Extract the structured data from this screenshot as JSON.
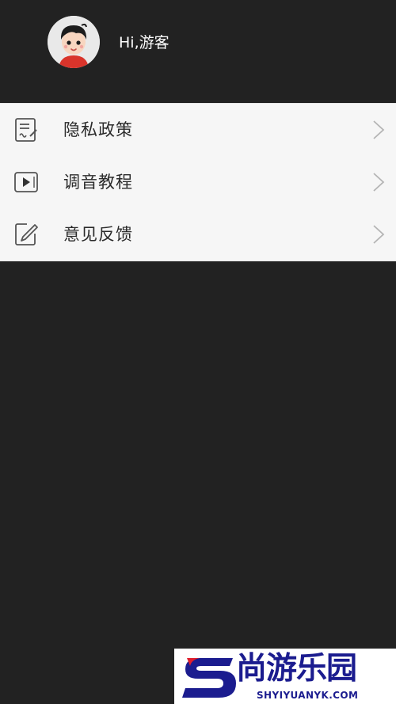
{
  "header": {
    "greeting": "Hi,游客",
    "avatar_icon": "cartoon-avatar"
  },
  "menu": {
    "items": [
      {
        "label": "隐私政策",
        "icon": "document-edit-icon"
      },
      {
        "label": "调音教程",
        "icon": "video-play-icon"
      },
      {
        "label": "意见反馈",
        "icon": "pencil-edit-icon"
      }
    ]
  },
  "watermark": {
    "text": "尚游乐园",
    "subtext": "SHYIYUANYK.COM",
    "logo": "S"
  },
  "colors": {
    "background": "#222222",
    "menu_bg": "#f6f6f6",
    "text_dark": "#2a2a2a",
    "watermark_blue": "#1b1c8f",
    "watermark_red": "#e01e2d"
  }
}
